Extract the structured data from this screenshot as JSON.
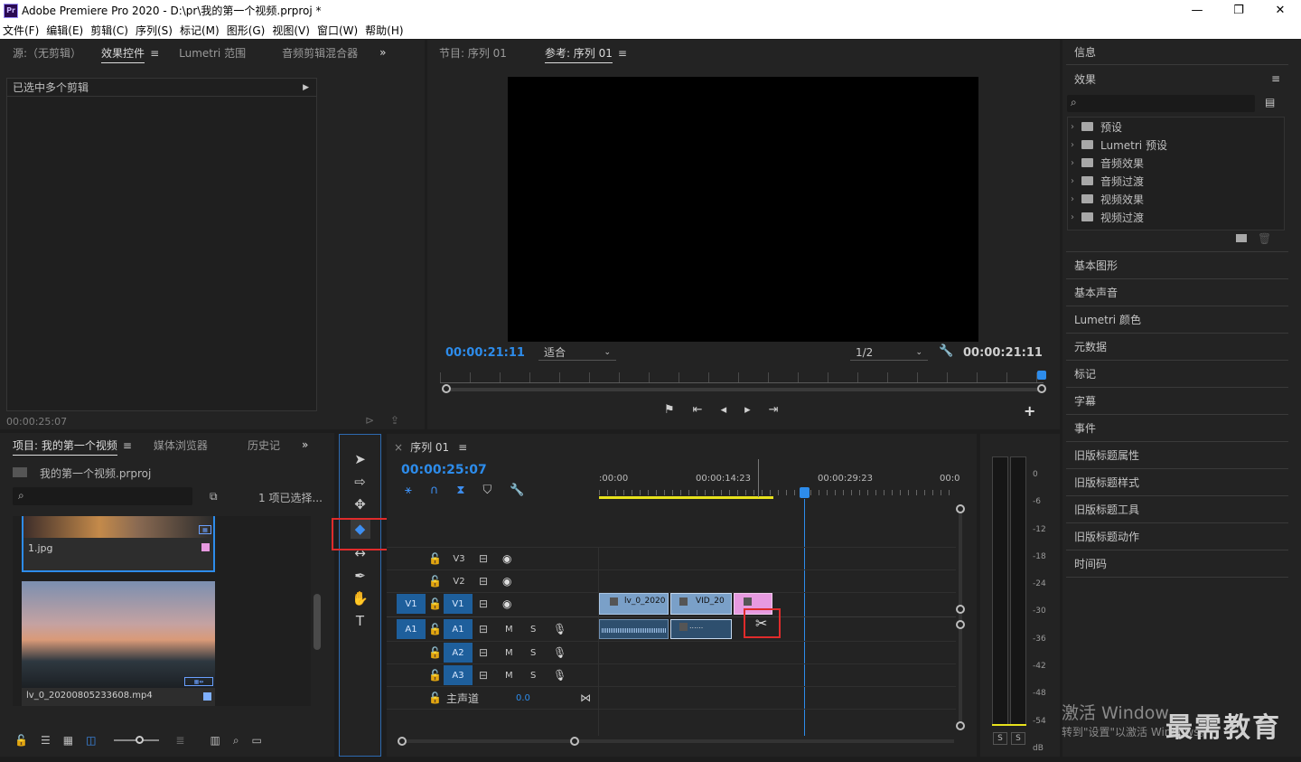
{
  "window": {
    "app_icon": "Pr",
    "title": "Adobe Premiere Pro 2020 - D:\\pr\\我的第一个视频.prproj *",
    "min": "—",
    "max": "❐",
    "close": "✕"
  },
  "menu": [
    "文件(F)",
    "编辑(E)",
    "剪辑(C)",
    "序列(S)",
    "标记(M)",
    "图形(G)",
    "视图(V)",
    "窗口(W)",
    "帮助(H)"
  ],
  "source_panel": {
    "tabs": [
      "源:（无剪辑）",
      "效果控件",
      "Lumetri 范围",
      "音频剪辑混合器"
    ],
    "more": "»",
    "header": "已选中多个剪辑",
    "timecode": "00:00:25:07"
  },
  "program_panel": {
    "tabs": [
      "节目: 序列 01",
      "参考: 序列 01"
    ],
    "timecode_left": "00:00:21:11",
    "fit": "适合",
    "resolution": "1/2",
    "timecode_right": "00:00:21:11"
  },
  "project_panel": {
    "tabs": [
      "项目: 我的第一个视频",
      "媒体浏览器",
      "历史记"
    ],
    "more": "»",
    "project_file": "我的第一个视频.prproj",
    "selection": "1 项已选择...",
    "items": [
      {
        "name": "1.jpg",
        "color": "#e79ae0"
      },
      {
        "name": "lv_0_20200805233608.mp4",
        "color": "#7fb0ff"
      }
    ]
  },
  "timeline": {
    "close": "×",
    "tab": "序列 01",
    "timecode": "00:00:25:07",
    "ruler": [
      ":00:00",
      "00:00:14:23",
      "00:00:29:23",
      "00:0"
    ],
    "video_tracks": [
      "V3",
      "V2",
      "V1"
    ],
    "audio_tracks": [
      "A1",
      "A2",
      "A3"
    ],
    "source_v": "V1",
    "source_a": "A1",
    "track_m": "M",
    "track_s": "S",
    "master": "主声道",
    "master_val": "0.0",
    "clips": {
      "c1": "lv_0_2020",
      "c2": "VID_20",
      "a2": "......"
    }
  },
  "meter": {
    "scale": [
      "0",
      "-6",
      "-12",
      "-18",
      "-24",
      "-30",
      "-36",
      "-42",
      "-48",
      "-54",
      "dB"
    ],
    "solo1": "S",
    "solo2": "S"
  },
  "right_panel": {
    "info": "信息",
    "effects": "效果",
    "effect_items": [
      "预设",
      "Lumetri 预设",
      "音频效果",
      "音频过渡",
      "视频效果",
      "视频过渡"
    ],
    "sections": [
      "基本图形",
      "基本声音",
      "Lumetri 颜色",
      "元数据",
      "标记",
      "字幕",
      "事件",
      "旧版标题属性",
      "旧版标题样式",
      "旧版标题工具",
      "旧版标题动作",
      "时间码"
    ]
  },
  "watermark": {
    "line1": "激活 Window",
    "line2": "转到\"设置\"以激活 Windows。",
    "brand": "最需教育"
  },
  "colors": {
    "accent": "#2d8ceb",
    "track_active": "#1e5f9c",
    "clip_video": "#7aa0c8",
    "clip_pink": "#e79ae0",
    "work_area": "#e8e21c",
    "highlight": "#e02b2b"
  }
}
